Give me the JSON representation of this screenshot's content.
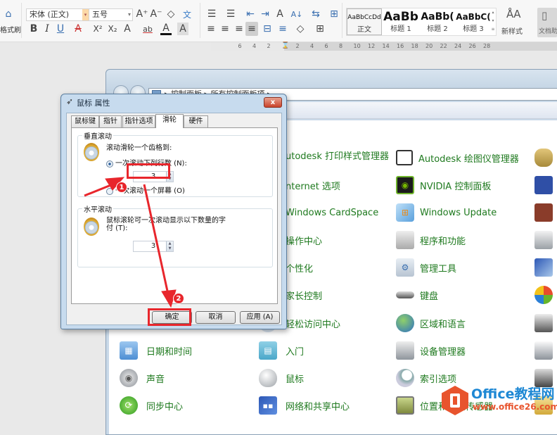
{
  "ribbon": {
    "format_painter_label": "格式刷",
    "font_name": "宋体 (正文)",
    "font_size": "五号",
    "styles": [
      {
        "preview": "AaBbCcDd",
        "name": "正文"
      },
      {
        "preview": "AaBb",
        "name": "标题 1"
      },
      {
        "preview": "AaBb(",
        "name": "标题 2"
      },
      {
        "preview": "AaBbC(",
        "name": "标题 3"
      }
    ],
    "new_style_label": "新样式",
    "doc_assistant_label": "文档助",
    "buttons": {
      "grow_font": "A⁺",
      "shrink_font": "A⁻",
      "clear_format": "◇",
      "phonetic": "文",
      "bold": "B",
      "italic": "I",
      "underline": "U",
      "strikethrough": "A",
      "superscript": "X²",
      "subscript": "X₂",
      "text_effect": "A",
      "highlight": "ab",
      "font_color": "A",
      "char_shading": "A",
      "bullets": "☰",
      "numbering": "☰",
      "decrease_indent": "⇤",
      "increase_indent": "⇥",
      "char_style": "A",
      "align_left": "≡",
      "align_center": "≡",
      "align_right": "≡",
      "justify": "≡",
      "distribute": "⊟",
      "sort": "A↓",
      "show_marks": "⇆",
      "borders_table": "⊞",
      "line_spacing": "≡",
      "shading": "◇",
      "borders": "⊞"
    }
  },
  "ruler": {
    "ticks": [
      "6",
      "4",
      "2",
      "2",
      "4",
      "6",
      "8",
      "10",
      "12",
      "14",
      "16",
      "18",
      "20",
      "22",
      "24",
      "26",
      "28"
    ]
  },
  "control_panel": {
    "breadcrumb": "▸ 控制面板 ▸ 所有控制面板项 ▸",
    "items_col1": [
      {
        "label": "日期和时间",
        "icon": "calendar-clock-icon"
      },
      {
        "label": "声音",
        "icon": "speaker-icon"
      },
      {
        "label": "同步中心",
        "icon": "sync-icon"
      }
    ],
    "items_col2": [
      {
        "label": "utodesk 打印样式管理器",
        "icon": "printer-style-icon"
      },
      {
        "label": "nternet 选项",
        "icon": "internet-options-icon"
      },
      {
        "label": "Windows CardSpace",
        "icon": "cardspace-icon"
      },
      {
        "label": "操作中心",
        "icon": "action-center-icon"
      },
      {
        "label": "个性化",
        "icon": "personalize-icon"
      },
      {
        "label": "家长控制",
        "icon": "parental-control-icon"
      },
      {
        "label": "轻松访问中心",
        "icon": "ease-of-access-icon"
      },
      {
        "label": "入门",
        "icon": "getting-started-icon"
      },
      {
        "label": "鼠标",
        "icon": "mouse-icon"
      },
      {
        "label": "网络和共享中心",
        "icon": "network-icon"
      }
    ],
    "items_col3": [
      {
        "label": "Autodesk 绘图仪管理器",
        "icon": "plotter-icon"
      },
      {
        "label": "NVIDIA 控制面板",
        "icon": "nvidia-icon"
      },
      {
        "label": "Windows Update",
        "icon": "windows-update-icon"
      },
      {
        "label": "程序和功能",
        "icon": "programs-icon"
      },
      {
        "label": "管理工具",
        "icon": "admin-tools-icon"
      },
      {
        "label": "键盘",
        "icon": "keyboard-icon"
      },
      {
        "label": "区域和语言",
        "icon": "globe-icon"
      },
      {
        "label": "设备管理器",
        "icon": "device-manager-icon"
      },
      {
        "label": "索引选项",
        "icon": "index-options-icon"
      },
      {
        "label": "位置和其他传感器",
        "icon": "location-sensor-icon"
      }
    ],
    "items_col4_icons": [
      "credential-icon",
      "sound-card-icon",
      "firewall-icon",
      "phone-modem-icon",
      "remote-icon",
      "windows-defender-icon",
      "system-icon",
      "devices-printers-icon",
      "display-icon",
      "folder-options-icon"
    ]
  },
  "dialog": {
    "title": "鼠标 属性",
    "close_label": "x",
    "tabs": [
      "鼠标键",
      "指针",
      "指针选项",
      "滑轮",
      "硬件"
    ],
    "active_tab": "滑轮",
    "vertical": {
      "legend": "垂直滚动",
      "prompt": "滚动滑轮一个齿格到:",
      "option_lines": "一次滚动下列行数 (N):",
      "lines_value": "3",
      "option_screen": "一次滚动一个屏幕 (O)",
      "selected": "lines"
    },
    "horizontal": {
      "legend": "水平滚动",
      "prompt": "鼠标滚轮可一次滚动显示以下数量的字符 (T):",
      "prompt_line1": "鼠标滚轮可一次滚动显示以下数量的字",
      "prompt_line2": "付 (T):",
      "chars_value": "3"
    },
    "buttons": {
      "ok": "确定",
      "cancel": "取消",
      "apply": "应用 (A)"
    }
  },
  "annotations": {
    "step1": "1",
    "step2": "2",
    "color": "#e8262c"
  },
  "watermark": {
    "title": "Office教程网",
    "url": "www.office26.com"
  }
}
